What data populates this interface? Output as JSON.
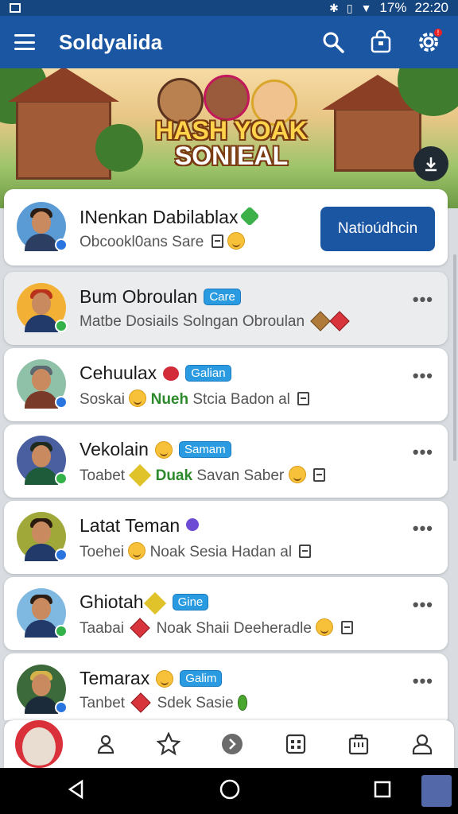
{
  "status_bar": {
    "time": "22:20",
    "battery": "17%"
  },
  "app_bar": {
    "title": "Soldyalida"
  },
  "banner": {
    "title_line1": "HASH YOAK",
    "title_line2": "SONIEAL"
  },
  "featured": {
    "name": "INenkan Dabilablax",
    "subtitle": "Obcookl0ans Sare",
    "button_label": "Natioúdhcin"
  },
  "contacts": [
    {
      "name": "Bum Obroulan",
      "tag": "Care",
      "preview": "Matbe Dosiails Solngan Obroulan",
      "status": "green"
    },
    {
      "name": "Cehuulax",
      "tag": "Galian",
      "preview_a": "Soskai",
      "preview_green": "Nueh",
      "preview_b": "Stcia Badon al",
      "status": "blue"
    },
    {
      "name": "Vekolain",
      "tag": "Samam",
      "preview_a": "Toabet",
      "preview_green": "Duak",
      "preview_b": "Savan Saber",
      "status": "green"
    },
    {
      "name": "Latat Teman",
      "preview_a": "Toehei",
      "preview_b": "Noak Sesia Hadan al",
      "status": "blue"
    },
    {
      "name": "Ghiotah",
      "tag": "Gine",
      "preview_a": "Taabai",
      "preview_b": "Noak Shaii Deeheradle",
      "status": "green"
    },
    {
      "name": "Temarax",
      "tag": "Galim",
      "preview_a": "Tanbet",
      "preview_b": "Sdek Sasie",
      "status": "blue"
    }
  ],
  "more_label": "•••",
  "icons": {
    "menu": "menu-icon",
    "search": "search-icon",
    "store": "shopping-bag-icon",
    "settings": "gear-icon",
    "download": "download-icon",
    "nav": [
      "people-icon",
      "star-icon",
      "play-icon",
      "grid-icon",
      "briefcase-icon",
      "person-icon"
    ]
  },
  "colors": {
    "primary": "#1b56a3",
    "status_bar": "#15467f",
    "tag": "#2a9be0",
    "online": "#33b24a",
    "verified_blue": "#2a74e0"
  }
}
